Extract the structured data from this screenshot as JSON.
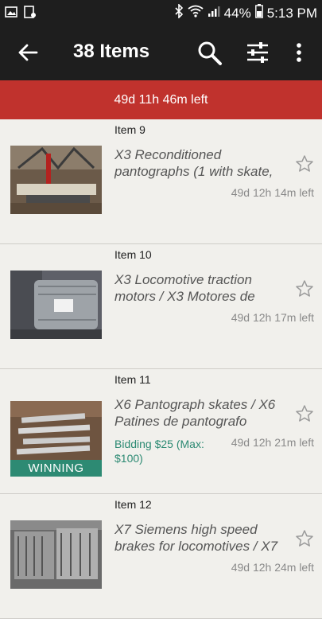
{
  "status_bar": {
    "battery": "44%",
    "time": "5:13 PM"
  },
  "app_bar": {
    "title": "38 Items",
    "icons": [
      "back-arrow-icon",
      "search-icon",
      "filter-icon",
      "more-vert-icon"
    ]
  },
  "banner": {
    "text": "49d 11h 46m left",
    "color": "#c0322d"
  },
  "items": [
    {
      "number": "Item 9",
      "title": "X3 Reconditioned pantographs (1 with skate,",
      "time_left": "49d 12h 14m left"
    },
    {
      "number": "Item 10",
      "title": "X3 Locomotive traction motors / X3 Motores de",
      "time_left": "49d 12h 17m left"
    },
    {
      "number": "Item 11",
      "title": "X6 Pantograph skates / X6 Patines de pantografo",
      "time_left": "49d 12h 21m left",
      "bid": "Bidding $25 (Max: $100)",
      "badge": "WINNING"
    },
    {
      "number": "Item 12",
      "title": "X7 Siemens high speed brakes for locomotives / X7",
      "time_left": "49d 12h 24m left"
    }
  ],
  "colors": {
    "app_bar": "#1e1e1e",
    "winning": "#2d8a73"
  }
}
